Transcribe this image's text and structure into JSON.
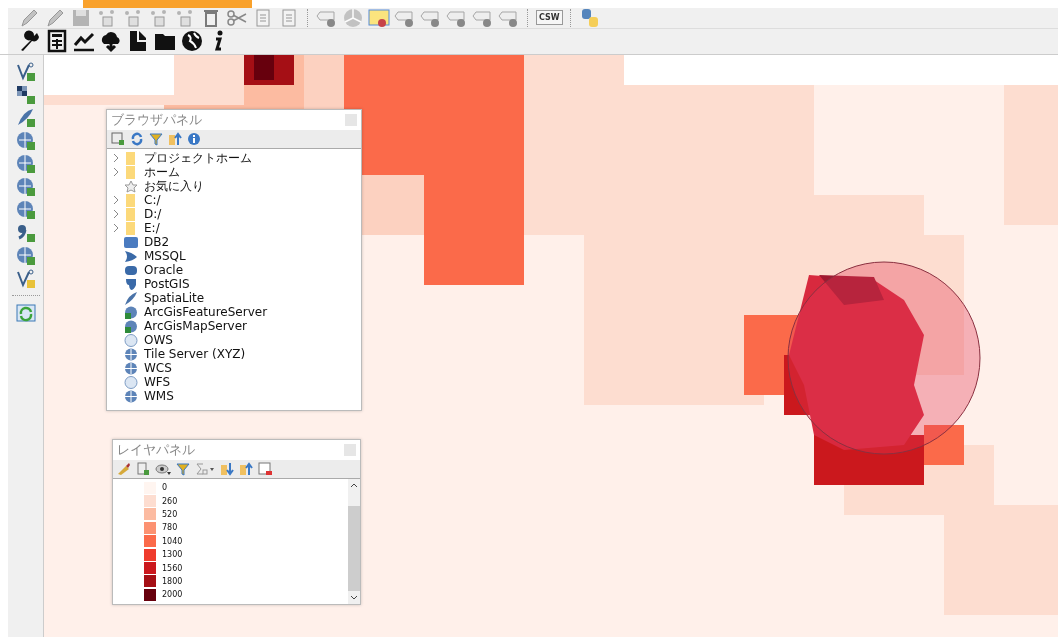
{
  "toolbar_top": {
    "csw_button": "CSW"
  },
  "browser_panel": {
    "title": "ブラウザパネル",
    "items": [
      {
        "label": "プロジェクトホーム",
        "kind": "folder",
        "expandable": true
      },
      {
        "label": "ホーム",
        "kind": "folder",
        "expandable": true
      },
      {
        "label": "お気に入り",
        "kind": "star",
        "expandable": false
      },
      {
        "label": "C:/",
        "kind": "folder",
        "expandable": true
      },
      {
        "label": "D:/",
        "kind": "folder",
        "expandable": true
      },
      {
        "label": "E:/",
        "kind": "folder",
        "expandable": true
      },
      {
        "label": "DB2",
        "kind": "db2",
        "expandable": false
      },
      {
        "label": "MSSQL",
        "kind": "mssql",
        "expandable": false
      },
      {
        "label": "Oracle",
        "kind": "oracle",
        "expandable": false
      },
      {
        "label": "PostGIS",
        "kind": "postgis",
        "expandable": false
      },
      {
        "label": "SpatiaLite",
        "kind": "feather",
        "expandable": false
      },
      {
        "label": "ArcGisFeatureServer",
        "kind": "globe-badge",
        "expandable": false
      },
      {
        "label": "ArcGisMapServer",
        "kind": "globe-badge",
        "expandable": false
      },
      {
        "label": "OWS",
        "kind": "globe-light",
        "expandable": false
      },
      {
        "label": "Tile Server (XYZ)",
        "kind": "globe",
        "expandable": false
      },
      {
        "label": "WCS",
        "kind": "globe",
        "expandable": false
      },
      {
        "label": "WFS",
        "kind": "globe-light",
        "expandable": false
      },
      {
        "label": "WMS",
        "kind": "globe",
        "expandable": false
      }
    ]
  },
  "layer_panel": {
    "title": "レイヤパネル",
    "legend": [
      {
        "label": "0",
        "color": "#fff5f0"
      },
      {
        "label": "260",
        "color": "#fdddd0"
      },
      {
        "label": "520",
        "color": "#fcbba1"
      },
      {
        "label": "780",
        "color": "#fc9272"
      },
      {
        "label": "1040",
        "color": "#fb6a4a"
      },
      {
        "label": "1300",
        "color": "#ef3b2c"
      },
      {
        "label": "1560",
        "color": "#cb181d"
      },
      {
        "label": "1800",
        "color": "#a50f15"
      },
      {
        "label": "2000",
        "color": "#67000d"
      }
    ]
  }
}
